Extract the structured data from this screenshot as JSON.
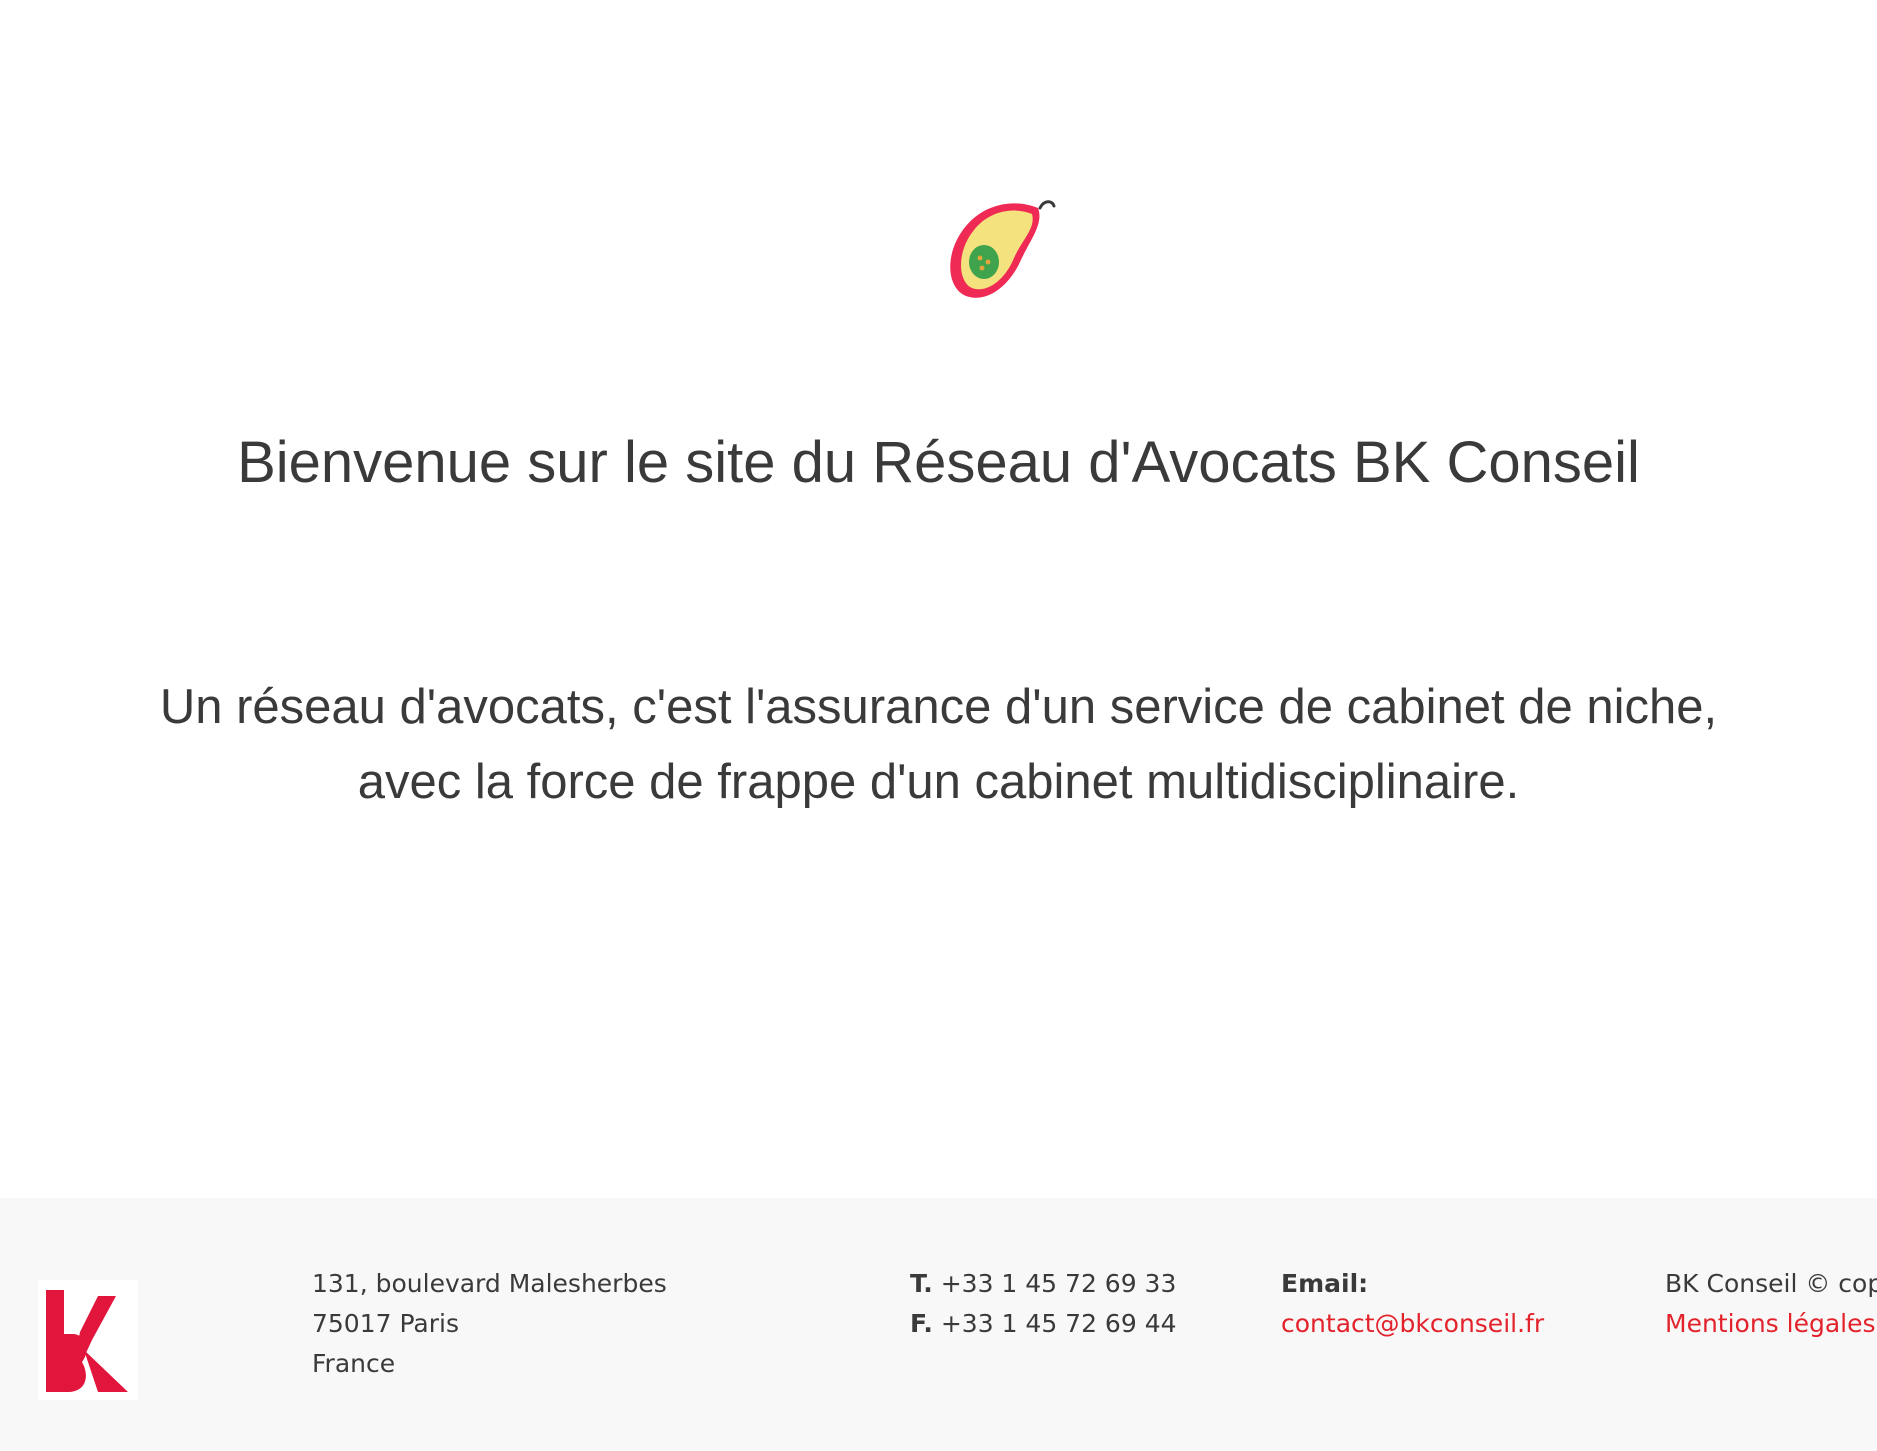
{
  "hero": {
    "icon": "avocado-icon",
    "title": "Bienvenue sur le site du Réseau d'Avocats BK Conseil",
    "tagline_line1": "Un réseau d'avocats, c'est l'assurance d'un service de cabinet de niche,",
    "tagline_line2": "avec la force de frappe d'un cabinet multidisciplinaire."
  },
  "footer": {
    "logo_icon": "bk-logo-icon",
    "address": {
      "street": "131, boulevard Malesherbes",
      "city": "75017 Paris",
      "country": "France"
    },
    "phone": {
      "tel_label": "T.",
      "tel_value": "+33 1 45 72 69 33",
      "fax_label": "F.",
      "fax_value": "+33 1 45 72 69 44"
    },
    "email": {
      "label": "Email:",
      "value": "contact@bkconseil.fr"
    },
    "copyright": {
      "text": "BK Conseil © cop",
      "legal_link": "Mentions légales"
    }
  },
  "colors": {
    "accent": "#e2232c",
    "text": "#3a3a3a",
    "footer_bg": "#f8f8f8",
    "avocado_skin": "#ee2a55",
    "avocado_flesh": "#f3e27e",
    "avocado_pit": "#3ea34c"
  }
}
